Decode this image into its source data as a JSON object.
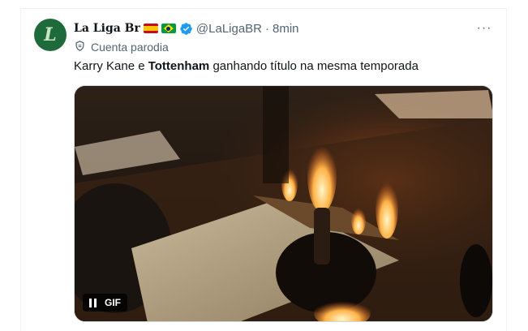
{
  "tweet": {
    "avatar_letter": "L",
    "display_name": "La Liga Br",
    "flags": [
      "spain-flag",
      "brazil-flag"
    ],
    "handle": "@LaLigaBR",
    "separator": "·",
    "time": "8min",
    "more": "···",
    "parody_label": "Cuenta parodia",
    "text_before": "Karry Kane e ",
    "text_bold": "Tottenham",
    "text_after": " ganhando título na mesma temporada",
    "media": {
      "type": "gif",
      "badge_label": "GIF",
      "content": "burning papers on a desk"
    }
  },
  "colors": {
    "text_primary": "#0f1419",
    "text_secondary": "#536471",
    "verified": "#1d9bf0",
    "avatar_bg": "#1f6a3a"
  }
}
